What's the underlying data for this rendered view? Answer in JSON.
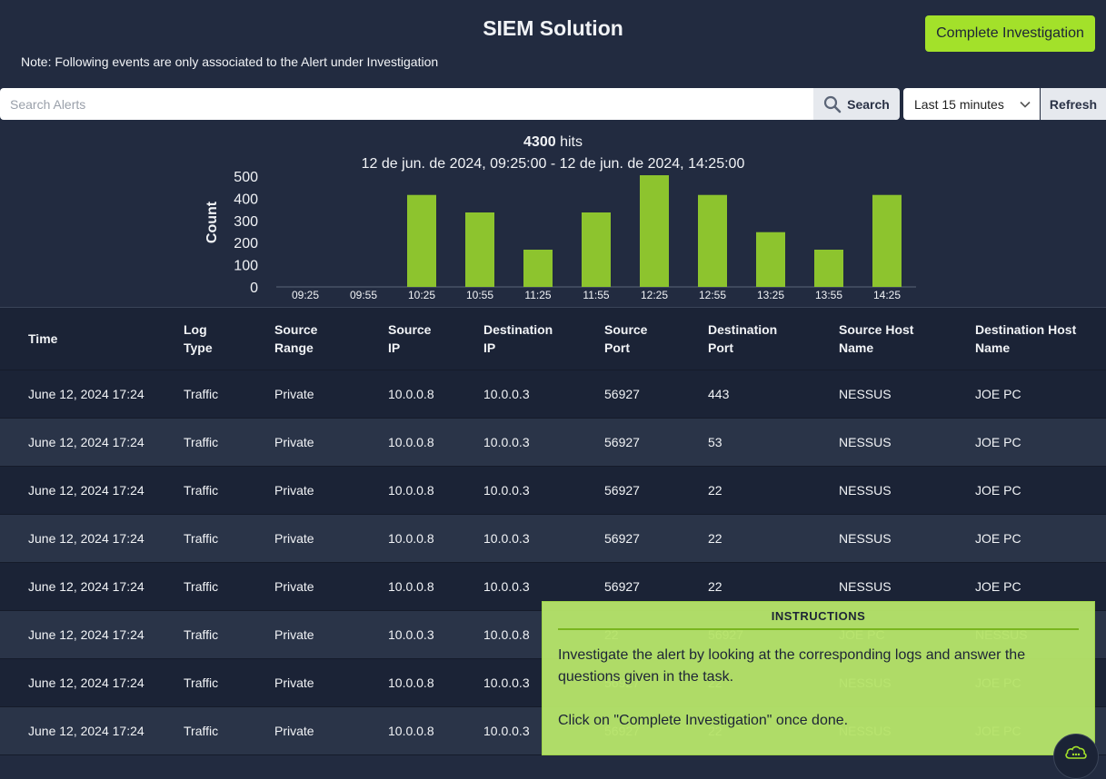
{
  "header": {
    "title": "SIEM Solution",
    "note": "Note: Following events are only associated to the Alert under Investigation",
    "complete_label": "Complete Investigation"
  },
  "search": {
    "placeholder": "Search Alerts",
    "button_label": "Search",
    "time_range": "Last 15 minutes",
    "refresh_label": "Refresh"
  },
  "summary": {
    "hits_count": "4300",
    "hits_label": "hits",
    "range": "12 de jun. de 2024, 09:25:00 - 12 de jun. de 2024, 14:25:00"
  },
  "colors": {
    "bar": "#8dc42e",
    "accent": "#a3e12a",
    "background": "#222b40"
  },
  "chart_data": {
    "type": "bar",
    "categories": [
      "09:25",
      "09:55",
      "10:25",
      "10:55",
      "11:25",
      "11:55",
      "12:25",
      "12:55",
      "13:25",
      "13:55",
      "14:25"
    ],
    "values": [
      0,
      0,
      420,
      340,
      170,
      340,
      510,
      420,
      250,
      170,
      420
    ],
    "ylabel": "Count",
    "yticks": [
      0,
      100,
      200,
      300,
      400,
      500
    ],
    "ylim": [
      0,
      510
    ]
  },
  "table": {
    "headers": [
      "Time",
      "Log Type",
      "Source Range",
      "Source IP",
      "Destination IP",
      "Source Port",
      "Destination Port",
      "Source Host Name",
      "Destination Host Name"
    ],
    "rows": [
      [
        "June 12, 2024 17:24",
        "Traffic",
        "Private",
        "10.0.0.8",
        "10.0.0.3",
        "56927",
        "443",
        "NESSUS",
        "JOE PC"
      ],
      [
        "June 12, 2024 17:24",
        "Traffic",
        "Private",
        "10.0.0.8",
        "10.0.0.3",
        "56927",
        "53",
        "NESSUS",
        "JOE PC"
      ],
      [
        "June 12, 2024 17:24",
        "Traffic",
        "Private",
        "10.0.0.8",
        "10.0.0.3",
        "56927",
        "22",
        "NESSUS",
        "JOE PC"
      ],
      [
        "June 12, 2024 17:24",
        "Traffic",
        "Private",
        "10.0.0.8",
        "10.0.0.3",
        "56927",
        "22",
        "NESSUS",
        "JOE PC"
      ],
      [
        "June 12, 2024 17:24",
        "Traffic",
        "Private",
        "10.0.0.8",
        "10.0.0.3",
        "56927",
        "22",
        "NESSUS",
        "JOE PC"
      ],
      [
        "June 12, 2024 17:24",
        "Traffic",
        "Private",
        "10.0.0.3",
        "10.0.0.8",
        "22",
        "56927",
        "JOE PC",
        "NESSUS"
      ],
      [
        "June 12, 2024 17:24",
        "Traffic",
        "Private",
        "10.0.0.8",
        "10.0.0.3",
        "56927",
        "22",
        "NESSUS",
        "JOE PC"
      ],
      [
        "June 12, 2024 17:24",
        "Traffic",
        "Private",
        "10.0.0.8",
        "10.0.0.3",
        "56927",
        "22",
        "NESSUS",
        "JOE PC"
      ]
    ]
  },
  "instructions": {
    "title": "INSTRUCTIONS",
    "paragraph1": "Investigate the alert by looking at the corresponding logs and answer the questions given in the task.",
    "paragraph2": "Click on \"Complete Investigation\" once done."
  },
  "icons": {
    "search": "search-icon",
    "dropdown": "chevron-down-icon",
    "chat": "chat-cloud-icon"
  }
}
